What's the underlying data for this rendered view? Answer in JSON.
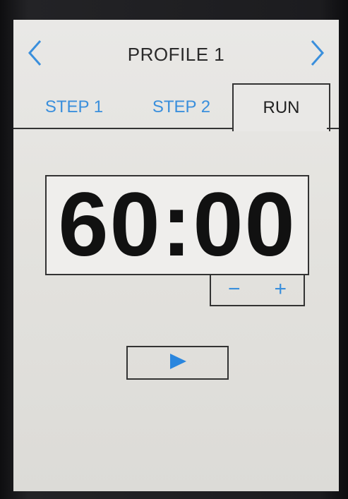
{
  "header": {
    "title": "PROFILE 1",
    "prev_icon": "chevron-left-icon",
    "next_icon": "chevron-right-icon"
  },
  "tabs": [
    {
      "label": "STEP 1",
      "active": false
    },
    {
      "label": "STEP 2",
      "active": false
    },
    {
      "label": "RUN",
      "active": true
    }
  ],
  "timer": {
    "value": "60:00",
    "decrement_label": "−",
    "increment_label": "+"
  },
  "controls": {
    "play_icon": "play-icon"
  },
  "colors": {
    "accent": "#3a8fdc",
    "text": "#222222",
    "screen_bg": "#e6e5e2"
  }
}
